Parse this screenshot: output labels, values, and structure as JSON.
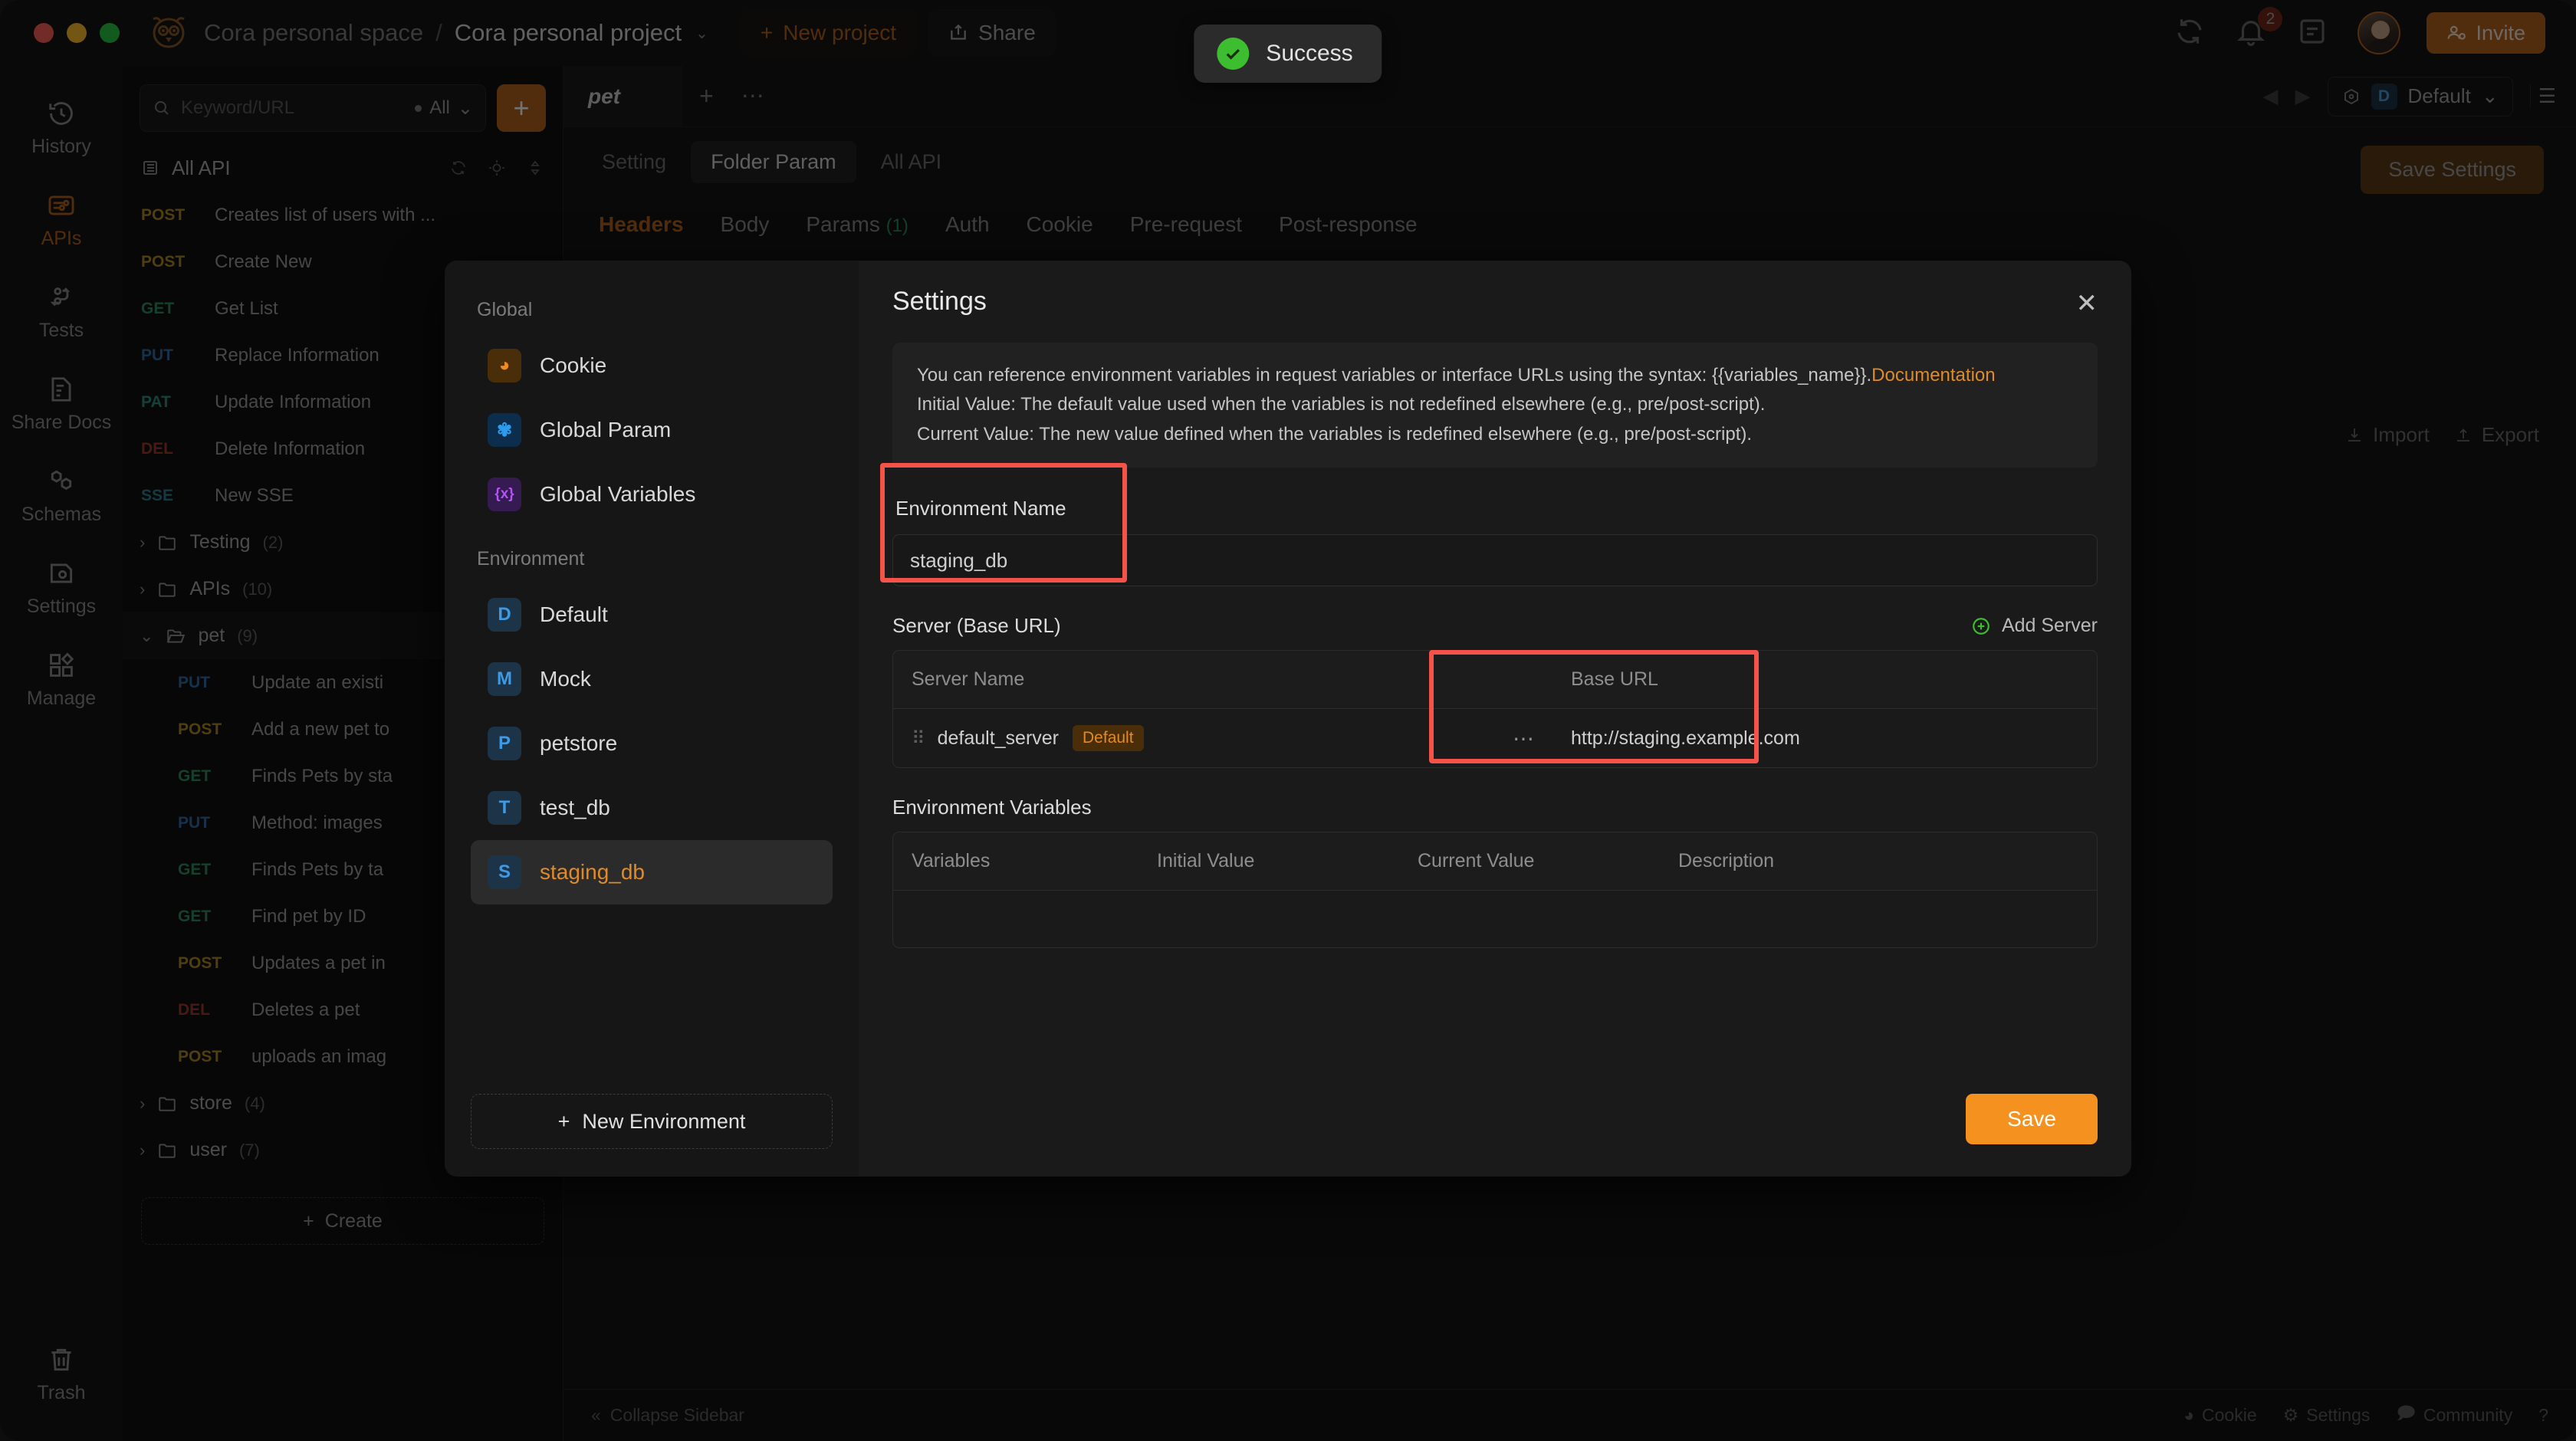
{
  "header": {
    "breadcrumb_space": "Cora personal space",
    "breadcrumb_sep": "/",
    "breadcrumb_project": "Cora personal project",
    "new_project": "New project",
    "share": "Share",
    "notification_count": "2",
    "invite": "Invite"
  },
  "toast": {
    "text": "Success"
  },
  "rail": {
    "items": [
      {
        "label": "History",
        "icon": "history-icon"
      },
      {
        "label": "APIs",
        "icon": "apis-icon"
      },
      {
        "label": "Tests",
        "icon": "tests-icon"
      },
      {
        "label": "Share Docs",
        "icon": "share-docs-icon"
      },
      {
        "label": "Schemas",
        "icon": "schemas-icon"
      },
      {
        "label": "Settings",
        "icon": "settings-icon"
      },
      {
        "label": "Manage",
        "icon": "manage-icon"
      }
    ],
    "trash": "Trash"
  },
  "sidebar": {
    "search_placeholder": "Keyword/URL",
    "filter": "All",
    "add_label": "+",
    "all_api": "All API",
    "apis": [
      {
        "method": "POST",
        "name": "Creates list of users with ...",
        "cls": "m-post"
      },
      {
        "method": "POST",
        "name": "Create New",
        "cls": "m-post"
      },
      {
        "method": "GET",
        "name": "Get List",
        "cls": "m-get"
      },
      {
        "method": "PUT",
        "name": "Replace Information",
        "cls": "m-put"
      },
      {
        "method": "PAT",
        "name": "Update Information",
        "cls": "m-pat"
      },
      {
        "method": "DEL",
        "name": "Delete Information",
        "cls": "m-del"
      },
      {
        "method": "SSE",
        "name": "New SSE",
        "cls": "m-sse"
      }
    ],
    "folders": [
      {
        "name": "Testing",
        "count": "(2)",
        "open": false
      },
      {
        "name": "APIs",
        "count": "(10)",
        "open": false
      }
    ],
    "pet_folder": {
      "name": "pet",
      "count": "(9)"
    },
    "pet_apis": [
      {
        "method": "PUT",
        "name": "Update an existi",
        "cls": "m-put"
      },
      {
        "method": "POST",
        "name": "Add a new pet to",
        "cls": "m-post"
      },
      {
        "method": "GET",
        "name": "Finds Pets by sta",
        "cls": "m-get"
      },
      {
        "method": "PUT",
        "name": "Method: images",
        "cls": "m-put"
      },
      {
        "method": "GET",
        "name": "Finds Pets by ta",
        "cls": "m-get"
      },
      {
        "method": "GET",
        "name": "Find pet by ID",
        "cls": "m-get"
      },
      {
        "method": "POST",
        "name": "Updates a pet in",
        "cls": "m-post"
      },
      {
        "method": "DEL",
        "name": "Deletes a pet",
        "cls": "m-del"
      },
      {
        "method": "POST",
        "name": "uploads an imag",
        "cls": "m-post"
      }
    ],
    "folders_after": [
      {
        "name": "store",
        "count": "(4)"
      },
      {
        "name": "user",
        "count": "(7)"
      }
    ],
    "create": "Create"
  },
  "main": {
    "doc_tab": "pet",
    "subtabs": [
      {
        "label": "Setting",
        "active": false
      },
      {
        "label": "Folder Param",
        "active": true
      },
      {
        "label": "All API",
        "active": false
      }
    ],
    "save_settings": "Save Settings",
    "env_selector": {
      "chip": "D",
      "label": "Default"
    },
    "request_tabs": [
      {
        "label": "Headers",
        "count": "",
        "active": true
      },
      {
        "label": "Body",
        "count": "",
        "active": false
      },
      {
        "label": "Params",
        "count": "(1)",
        "active": false
      },
      {
        "label": "Auth",
        "count": "",
        "active": false
      },
      {
        "label": "Cookie",
        "count": "",
        "active": false
      },
      {
        "label": "Pre-request",
        "count": "",
        "active": false
      },
      {
        "label": "Post-response",
        "count": "",
        "active": false
      }
    ],
    "import": "Import",
    "export": "Export"
  },
  "bottombar": {
    "collapse": "Collapse Sidebar",
    "cookie": "Cookie",
    "settings": "Settings",
    "community": "Community"
  },
  "modal": {
    "title": "Settings",
    "close": "✕",
    "info": {
      "line1_pre": "You can reference environment variables in request variables or interface URLs using the syntax: {{variables_name}}.",
      "line1_link": "Documentation",
      "line2": "Initial Value: The default value used when the variables is not redefined elsewhere (e.g., pre/post-script).",
      "line3": "Current Value: The new value defined when the variables is redefined elsewhere (e.g., pre/post-script)."
    },
    "nav": {
      "global_head": "Global",
      "global_items": [
        {
          "label": "Cookie",
          "icon": "cookie-icon",
          "cls": "ic-cookie",
          "glyph": "◕"
        },
        {
          "label": "Global Param",
          "icon": "global-param-icon",
          "cls": "ic-gparam",
          "glyph": "✾"
        },
        {
          "label": "Global Variables",
          "icon": "global-variables-icon",
          "cls": "ic-gvar",
          "glyph": "{x}"
        }
      ],
      "environment_head": "Environment",
      "environment_items": [
        {
          "label": "Default",
          "chip": "D",
          "active": false
        },
        {
          "label": "Mock",
          "chip": "M",
          "active": false
        },
        {
          "label": "petstore",
          "chip": "P",
          "active": false
        },
        {
          "label": "test_db",
          "chip": "T",
          "active": false
        },
        {
          "label": "staging_db",
          "chip": "S",
          "active": true
        }
      ],
      "new_environment": "New Environment"
    },
    "env_name_label": "Environment Name",
    "env_name_value": "staging_db",
    "server_section_title": "Server (Base URL)",
    "add_server": "Add Server",
    "server_table": {
      "headers": [
        "Server Name",
        "Base URL"
      ],
      "rows": [
        {
          "name": "default_server",
          "badge": "Default",
          "url": "http://staging.example.com"
        }
      ]
    },
    "env_vars_title": "Environment Variables",
    "env_vars_headers": [
      "Variables",
      "Initial Value",
      "Current Value",
      "Description"
    ],
    "env_vars_rows": [],
    "save": "Save"
  },
  "colors": {
    "accent": "#b4651d",
    "orange": "#e08a28",
    "save_orange": "#f5911e",
    "success_green": "#3dbe30",
    "highlight_red": "#f5534a"
  }
}
